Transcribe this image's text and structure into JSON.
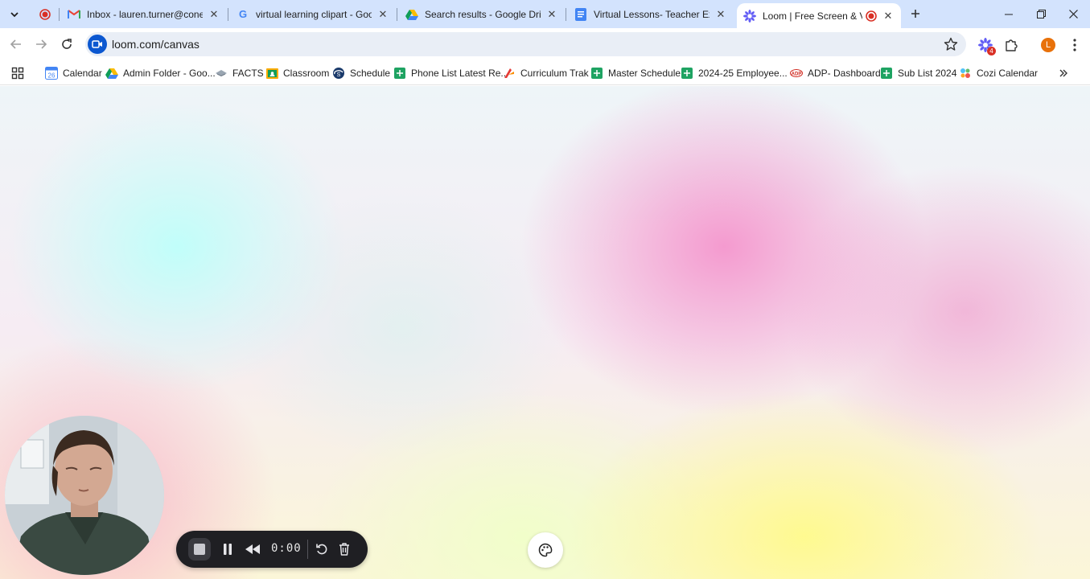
{
  "tabs": [
    {
      "title": "",
      "favicon": "record-icon",
      "closable": false
    },
    {
      "title": "Inbox - lauren.turner@conestoga",
      "favicon": "gmail-icon",
      "closable": true
    },
    {
      "title": "virtual learning clipart - Google",
      "favicon": "google-icon",
      "closable": true
    },
    {
      "title": "Search results - Google Drive",
      "favicon": "drive-icon",
      "closable": true
    },
    {
      "title": "Virtual Lessons- Teacher Expectations",
      "favicon": "docs-icon",
      "closable": true
    },
    {
      "title": "Loom | Free Screen & Video",
      "favicon": "loom-icon",
      "closable": true,
      "active": true,
      "recording": true
    }
  ],
  "omnibox": {
    "url": "loom.com/canvas"
  },
  "toolbar": {
    "extensions_badge": "4",
    "profile_initial": "L"
  },
  "bookmarks": [
    {
      "label": "Calendar",
      "icon": "calendar-icon"
    },
    {
      "label": "Admin Folder - Goo...",
      "icon": "drive-icon"
    },
    {
      "label": "FACTS",
      "icon": "facts-icon"
    },
    {
      "label": "Classroom",
      "icon": "classroom-icon"
    },
    {
      "label": "Schedule",
      "icon": "schedule-icon"
    },
    {
      "label": "Phone List Latest Re...",
      "icon": "sheets-icon"
    },
    {
      "label": "Curriculum Trak",
      "icon": "curriculum-icon"
    },
    {
      "label": "Master Schedule",
      "icon": "sheets-icon"
    },
    {
      "label": "2024-25 Employee...",
      "icon": "sheets-icon"
    },
    {
      "label": "ADP- Dashboard",
      "icon": "adp-icon"
    },
    {
      "label": "Sub List 2024",
      "icon": "sheets-icon"
    },
    {
      "label": "Cozi Calendar",
      "icon": "cozi-icon"
    }
  ],
  "calendar_icon_text": "26",
  "adp_icon_text": "ADP",
  "recorder": {
    "timer": "0:00"
  },
  "colors": {
    "tabstrip": "#d3e3fd",
    "loom_brand": "#625df5",
    "recording_red": "#d93025",
    "sheets_green": "#1ea362"
  }
}
